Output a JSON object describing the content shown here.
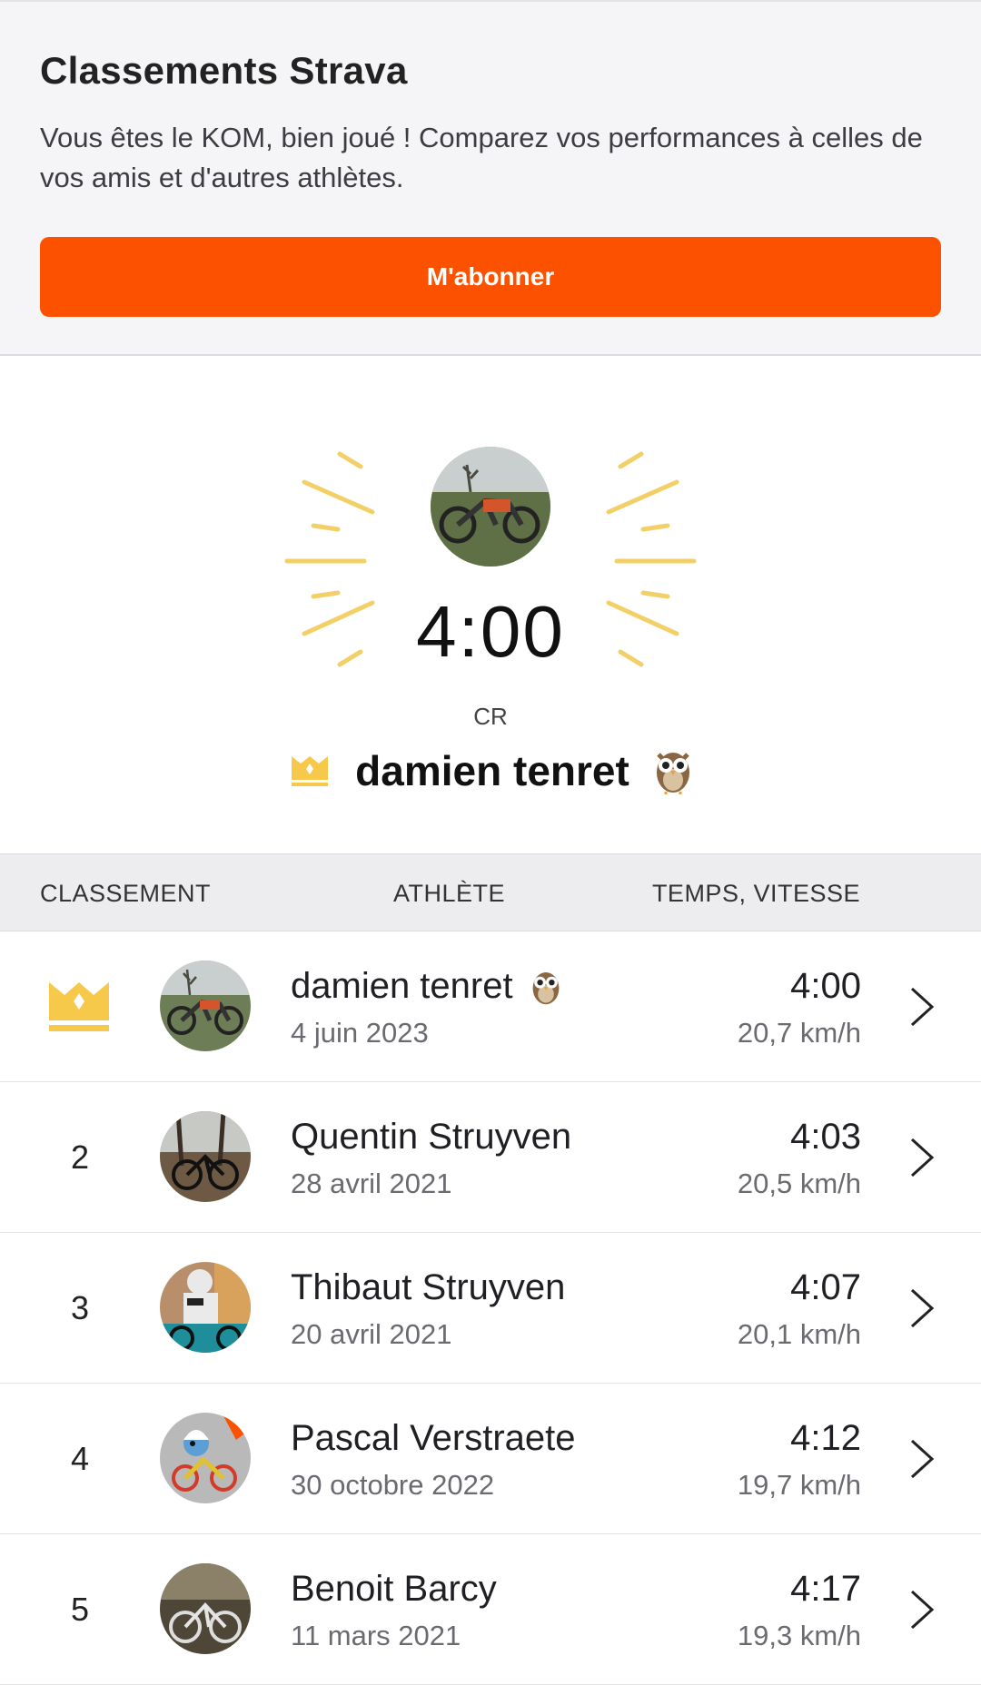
{
  "promo": {
    "title": "Classements Strava",
    "text": "Vous êtes le KOM, bien joué ! Comparez vos performances à celles de vos amis et d'autres athlètes.",
    "cta_label": "M'abonner"
  },
  "hero": {
    "time": "4:00",
    "label": "CR",
    "name": "damien tenret",
    "crown_icon": "crown-icon",
    "emoji": "owl-icon"
  },
  "table": {
    "headers": {
      "rank": "CLASSEMENT",
      "athlete": "ATHLÈTE",
      "time": "TEMPS, VITESSE"
    },
    "rows": [
      {
        "rank": "",
        "crown": true,
        "name": "damien tenret",
        "emoji": "owl-icon",
        "date": "4 juin 2023",
        "time": "4:00",
        "speed": "20,7 km/h"
      },
      {
        "rank": "2",
        "name": "Quentin Struyven",
        "date": "28 avril 2021",
        "time": "4:03",
        "speed": "20,5 km/h"
      },
      {
        "rank": "3",
        "name": "Thibaut Struyven",
        "date": "20 avril 2021",
        "time": "4:07",
        "speed": "20,1 km/h"
      },
      {
        "rank": "4",
        "name": "Pascal Verstraete",
        "date": "30 octobre 2022",
        "time": "4:12",
        "speed": "19,7 km/h"
      },
      {
        "rank": "5",
        "name": "Benoit Barcy",
        "date": "11 mars 2021",
        "time": "4:17",
        "speed": "19,3 km/h"
      }
    ]
  },
  "colors": {
    "accent": "#fc5200",
    "crown": "#f6c94a",
    "rays": "#f2d067"
  }
}
